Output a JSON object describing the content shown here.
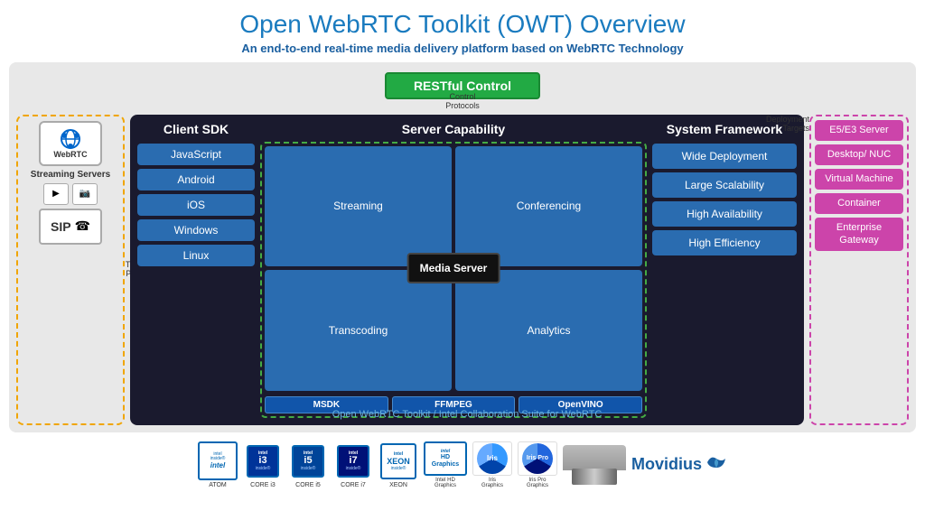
{
  "header": {
    "title": "Open WebRTC Toolkit (OWT) Overview",
    "subtitle": "An end-to-end real-time media delivery platform based on WebRTC Technology"
  },
  "restful": {
    "label": "RESTful Control",
    "control_protocols": "Control\nProtocols"
  },
  "left_panel": {
    "webrtc_label": "WebRTC",
    "streaming_servers_label": "Streaming Servers",
    "transport_protocols": "Transport\nProtocols",
    "sip_label": "SIP"
  },
  "client_sdk": {
    "title": "Client SDK",
    "items": [
      "JavaScript",
      "Android",
      "iOS",
      "Windows",
      "Linux"
    ]
  },
  "server_capability": {
    "title": "Server Capability",
    "cells": [
      "Streaming",
      "Conferencing",
      "Transcoding",
      "Analytics"
    ],
    "media_server": "Media Server",
    "sdk_tags": [
      "MSDK",
      "FFMPEG",
      "OpenVINO"
    ]
  },
  "system_framework": {
    "title": "System Framework",
    "items": [
      "Wide Deployment",
      "Large Scalability",
      "High Availability",
      "High Efficiency"
    ]
  },
  "deployment_targets": {
    "label": "Deployment Targets",
    "items": [
      "E5/E3\nServer",
      "Desktop/\nNUC",
      "Virtual\nMachine",
      "Container",
      "Enterprise\nGateway"
    ]
  },
  "bottom_bar": {
    "footer_label": "Open WebRTC Toolkit / Intel Collaboration Suite for WebRTC",
    "chips": [
      "ATOM",
      "CORE i3",
      "CORE i5",
      "CORE i7",
      "XEON",
      "Intel HD Graphics",
      "Iris Graphics",
      "Iris Pro Graphics"
    ],
    "movidius_label": "Movidius"
  },
  "colors": {
    "accent_blue": "#1a7bbf",
    "dark_blue": "#1a5fa0",
    "green": "#22aa44",
    "button_blue": "#2a6cb0",
    "magenta": "#cc44aa",
    "dark_bg": "#1a1a2e",
    "yellow_dash": "#f0a500"
  }
}
